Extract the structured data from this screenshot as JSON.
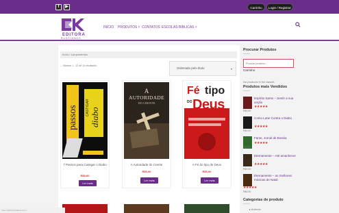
{
  "topbar": {
    "social": [
      "f",
      "▶"
    ],
    "account_label": "Carrinho",
    "login_label": "Login / Registrar"
  },
  "header": {
    "logo_text": "EDITORA",
    "logo_sub": "RUSSIANOS",
    "nav": [
      "INÍCIO",
      "PRODUTOS ˅",
      "CONTATOS",
      "ESCOLAS BÍBLICAS ˅"
    ]
  },
  "breadcrumb": "Início / Lançamentos",
  "result_count": "← Mostrar 1 - 12 de 14 resultados",
  "ordering": {
    "selected": "Ordenado pelo titulo",
    "arrow": "▾"
  },
  "products": [
    {
      "title": "7 Passos para Castigar o Diabo",
      "price": "R$0,00",
      "button": "Ler mais"
    },
    {
      "title": "A Autoridade do Crente",
      "price": "R$0,00",
      "button": "Ler mais"
    },
    {
      "title": "A Fé do tipo de Deus",
      "price": "R$0,00",
      "button": "Ler mais"
    }
  ],
  "covers": [
    {
      "top_text": "CASTIGAR",
      "big_text": "diabo",
      "side_text": "passos"
    },
    {
      "top_text": "A",
      "big_text": "AUTORIDADE",
      "sub_text": "DO CRENTE"
    },
    {
      "top_text": "Fé",
      "big_text": "tipo",
      "sub_text": "Deus",
      "small": "DO"
    }
  ],
  "sidebar": {
    "search_title": "Procurar Produtos",
    "search_placeholder": "Procurar produtos…",
    "search_button": "Carrinho",
    "cart_empty": "No products in the basket.",
    "best_title": "Produtos mais Vendidos",
    "items": [
      {
        "name": "Espírito Santo – Sentir a sua unção",
        "stars": "★★★★★",
        "price": "R$0,00"
      },
      {
        "name": "Como Lutar Contra o Diabo",
        "stars": "★★★★★",
        "price": "R$0,00"
      },
      {
        "name": "Fame, Jornal de Bosnia",
        "stars": "★★★★★",
        "price": "R$0,00"
      },
      {
        "name": "Eternamente – Até amanhecer",
        "stars": "★★★★★",
        "price": "R$0,00"
      },
      {
        "name": "Eternamente – as melhores músicas de Natal",
        "stars": "★★★★★",
        "price": "R$0,00"
      }
    ],
    "categories_title": "Categorias de produto",
    "category_first": "▸ Autores"
  },
  "status_text": "https://editoracristiana.com/...",
  "colors": {
    "brand": "#6b2d8c",
    "accent_red": "#c33333",
    "topbar": "#6b2d8c"
  }
}
